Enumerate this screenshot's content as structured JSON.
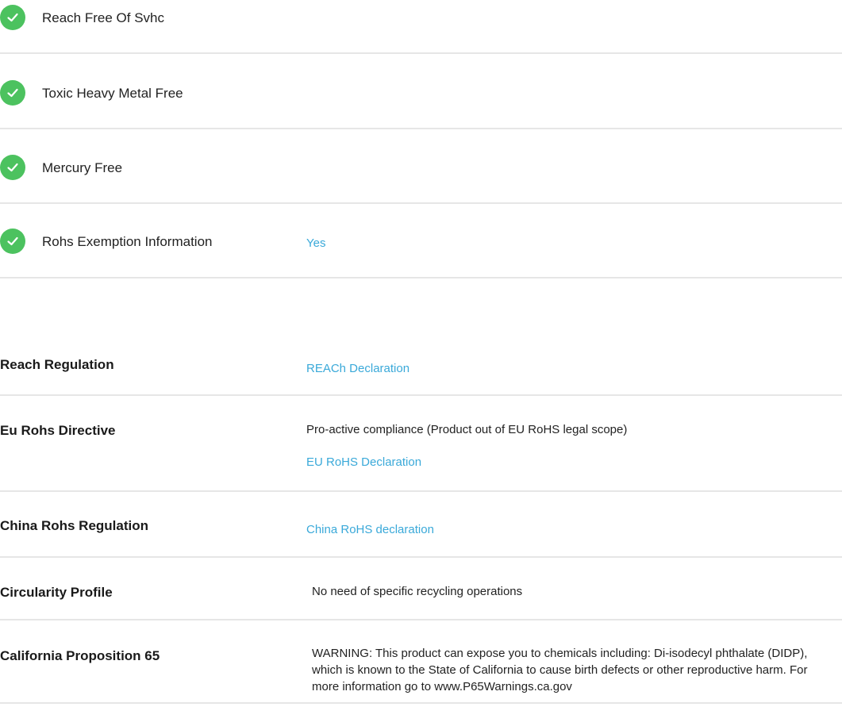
{
  "environmental_checks": [
    {
      "label": "Reach Free Of Svhc",
      "value": ""
    },
    {
      "label": "Toxic Heavy Metal Free",
      "value": ""
    },
    {
      "label": "Mercury Free",
      "value": ""
    },
    {
      "label": "Rohs Exemption Information",
      "value": "Yes"
    }
  ],
  "regulations": {
    "reach": {
      "label": "Reach Regulation",
      "link": "REACh Declaration"
    },
    "eu_rohs": {
      "label": "Eu Rohs Directive",
      "text": "Pro-active compliance (Product out of EU RoHS legal scope)",
      "link": "EU RoHS Declaration"
    },
    "china_rohs": {
      "label": "China Rohs Regulation",
      "link": "China RoHS declaration"
    },
    "circularity": {
      "label": "Circularity Profile",
      "text": "No need of specific recycling operations"
    },
    "prop65": {
      "label": "California Proposition 65",
      "text": "WARNING: This product can expose you to chemicals including: Di-isodecyl phthalate (DIDP), which is known to the State of California to cause birth defects or other reproductive harm. For more information go to www.P65Warnings.ca.gov"
    }
  },
  "colors": {
    "check": "#4cc25f",
    "link": "#3aa9d9",
    "divider": "#e6e6e6"
  }
}
